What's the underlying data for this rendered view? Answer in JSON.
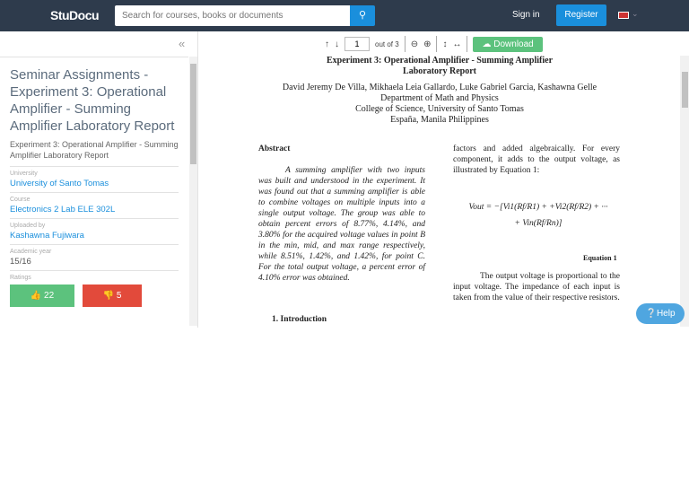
{
  "header": {
    "logo": "StuDocu",
    "search_placeholder": "Search for courses, books or documents",
    "sign_in": "Sign in",
    "register": "Register"
  },
  "toolbar": {
    "collapse": "«",
    "page": "1",
    "out_of": "out of 3",
    "download": "Download"
  },
  "sidebar": {
    "title": "Seminar Assignments - Experiment 3: Operational Amplifier - Summing Amplifier Laboratory Report",
    "subtitle": "Experiment 3: Operational Amplifier - Summing Amplifier Laboratory Report",
    "university_label": "University",
    "university": "University of Santo Tomas",
    "course_label": "Course",
    "course": "Electronics 2 Lab ELE 302L",
    "uploaded_label": "Uploaded by",
    "uploader": "Kashawna Fujiwara",
    "year_label": "Academic year",
    "year": "15/16",
    "ratings_label": "Ratings",
    "likes": "22",
    "dislikes": "5"
  },
  "document": {
    "title1": "Experiment 3: Operational Amplifier - Summing Amplifier",
    "title2": "Laboratory Report",
    "authors": "David Jeremy De Villa, Mikhaela Leia Gallardo, Luke Gabriel Garcia, Kashawna Gelle",
    "dept": "Department of Math and Physics",
    "college": "College of Science, University of Santo Tomas",
    "location": "España, Manila Philippines",
    "abstract_heading": "Abstract",
    "abstract": "A summing amplifier with two inputs was built and understood in the experiment. It was found out that a summing amplifier is able to combine voltages on multiple inputs into a single output voltage. The group was able to obtain percent errors of 8.77%, 4.14%, and 3.80% for the acquired voltage values in point B in the min, mid, and max range respectively, while 8.51%, 1.42%, and 1.42%, for point C. For the total output voltage, a percent error of 4.10% error was obtained.",
    "intro_heading": "1.   Introduction",
    "right_text": "factors and added algebraically. For every component, it adds to the output voltage, as illustrated by Equation 1:",
    "equation": "Vout = −[Vi1(Rf/R1) + +Vi2(Rf/R2) + ··· + Vin(Rf/Rn)]",
    "equation_label": "Equation 1",
    "right_text2": "The output voltage is proportional to the input voltage. The impedance of each input is taken from the value of their respective resistors."
  },
  "help": "Help"
}
